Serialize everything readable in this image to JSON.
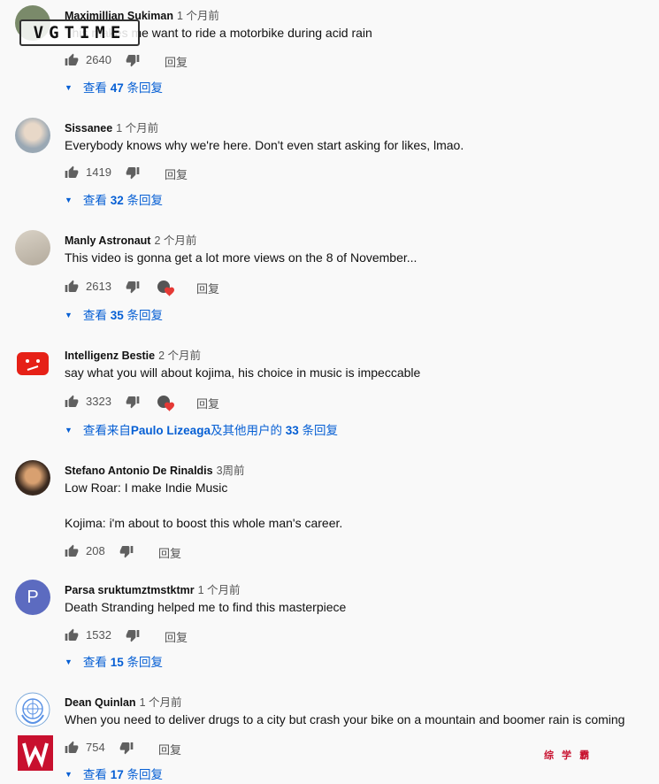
{
  "colors": {
    "link": "#065fd4",
    "background": "#f9f9f9",
    "heart": "#e53935"
  },
  "reply_label": "回复",
  "comments": [
    {
      "author": "Maximillian Sukiman",
      "time": "1 个月前",
      "text": "This makes me want to ride a motorbike during acid rain",
      "likes": "2640",
      "hearted": false,
      "replies_prefix": "查看 ",
      "replies_count": "47",
      "replies_suffix": " 条回复"
    },
    {
      "author": "Sissanee",
      "time": "1 个月前",
      "text": "Everybody knows why we're here. Don't even start asking for likes, lmao.",
      "likes": "1419",
      "hearted": false,
      "replies_prefix": "查看 ",
      "replies_count": "32",
      "replies_suffix": " 条回复"
    },
    {
      "author": "Manly Astronaut",
      "time": "2 个月前",
      "text": "This video is gonna get a lot more views on the 8 of November...",
      "likes": "2613",
      "hearted": true,
      "replies_prefix": "查看 ",
      "replies_count": "35",
      "replies_suffix": " 条回复"
    },
    {
      "author": "Intelligenz Bestie",
      "time": "2 个月前",
      "text": "say what you will about kojima, his choice in music is impeccable",
      "likes": "3323",
      "hearted": true,
      "replies_prefix": "查看来自",
      "replies_name": "Paulo Lizeaga",
      "replies_mid": "及其他用户的 ",
      "replies_count": "33",
      "replies_suffix": " 条回复"
    },
    {
      "author": "Stefano Antonio De Rinaldis",
      "time": "3周前",
      "text": "Low Roar: I make Indie Music",
      "text2": "Kojima: i'm about to boost this whole man's career.",
      "likes": "208",
      "hearted": false
    },
    {
      "author": "Parsa sruktumztmstktmr",
      "time": "1 个月前",
      "text": "Death Stranding helped me to find this masterpiece",
      "likes": "1532",
      "hearted": false,
      "replies_prefix": "查看 ",
      "replies_count": "15",
      "replies_suffix": " 条回复"
    },
    {
      "author": "Dean Quinlan",
      "time": "1 个月前",
      "text": "When you need to deliver drugs to a city but crash your bike on a mountain and boomer rain is coming",
      "likes": "754",
      "hearted": false,
      "replies_prefix": "查看 ",
      "replies_count": "17",
      "replies_suffix": " 条回复"
    }
  ],
  "avatars": {
    "parsa_initial": "P"
  },
  "watermarks": {
    "top_left": "VGTIME",
    "bottom_right": "综 学 霸"
  }
}
